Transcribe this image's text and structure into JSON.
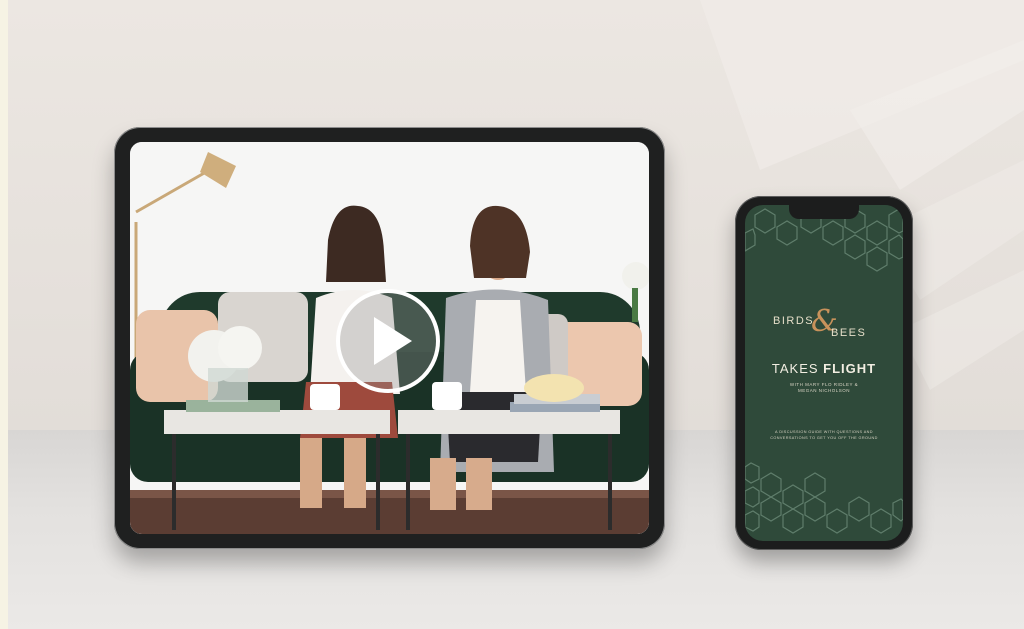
{
  "tablet": {
    "video": {
      "play_icon": "play-icon",
      "accent": "#ffffff"
    }
  },
  "phone": {
    "screen_background": "#2f4a3a",
    "brand": {
      "word1": "BIRDS",
      "ampersand": "&",
      "word2": "BEES"
    },
    "title": {
      "light": "TAKES",
      "bold": "FLIGHT"
    },
    "authors_line1": "WITH MARY FLO RIDLEY &",
    "authors_line2": "MEGAN NICHOLSON",
    "tagline_line1": "A DISCUSSION GUIDE WITH QUESTIONS AND",
    "tagline_line2": "CONVERSATIONS TO GET YOU OFF THE GROUND",
    "colors": {
      "text": "#e6dfc9",
      "accent": "#c8925b",
      "hex_pattern": "#5f7d6b"
    }
  }
}
